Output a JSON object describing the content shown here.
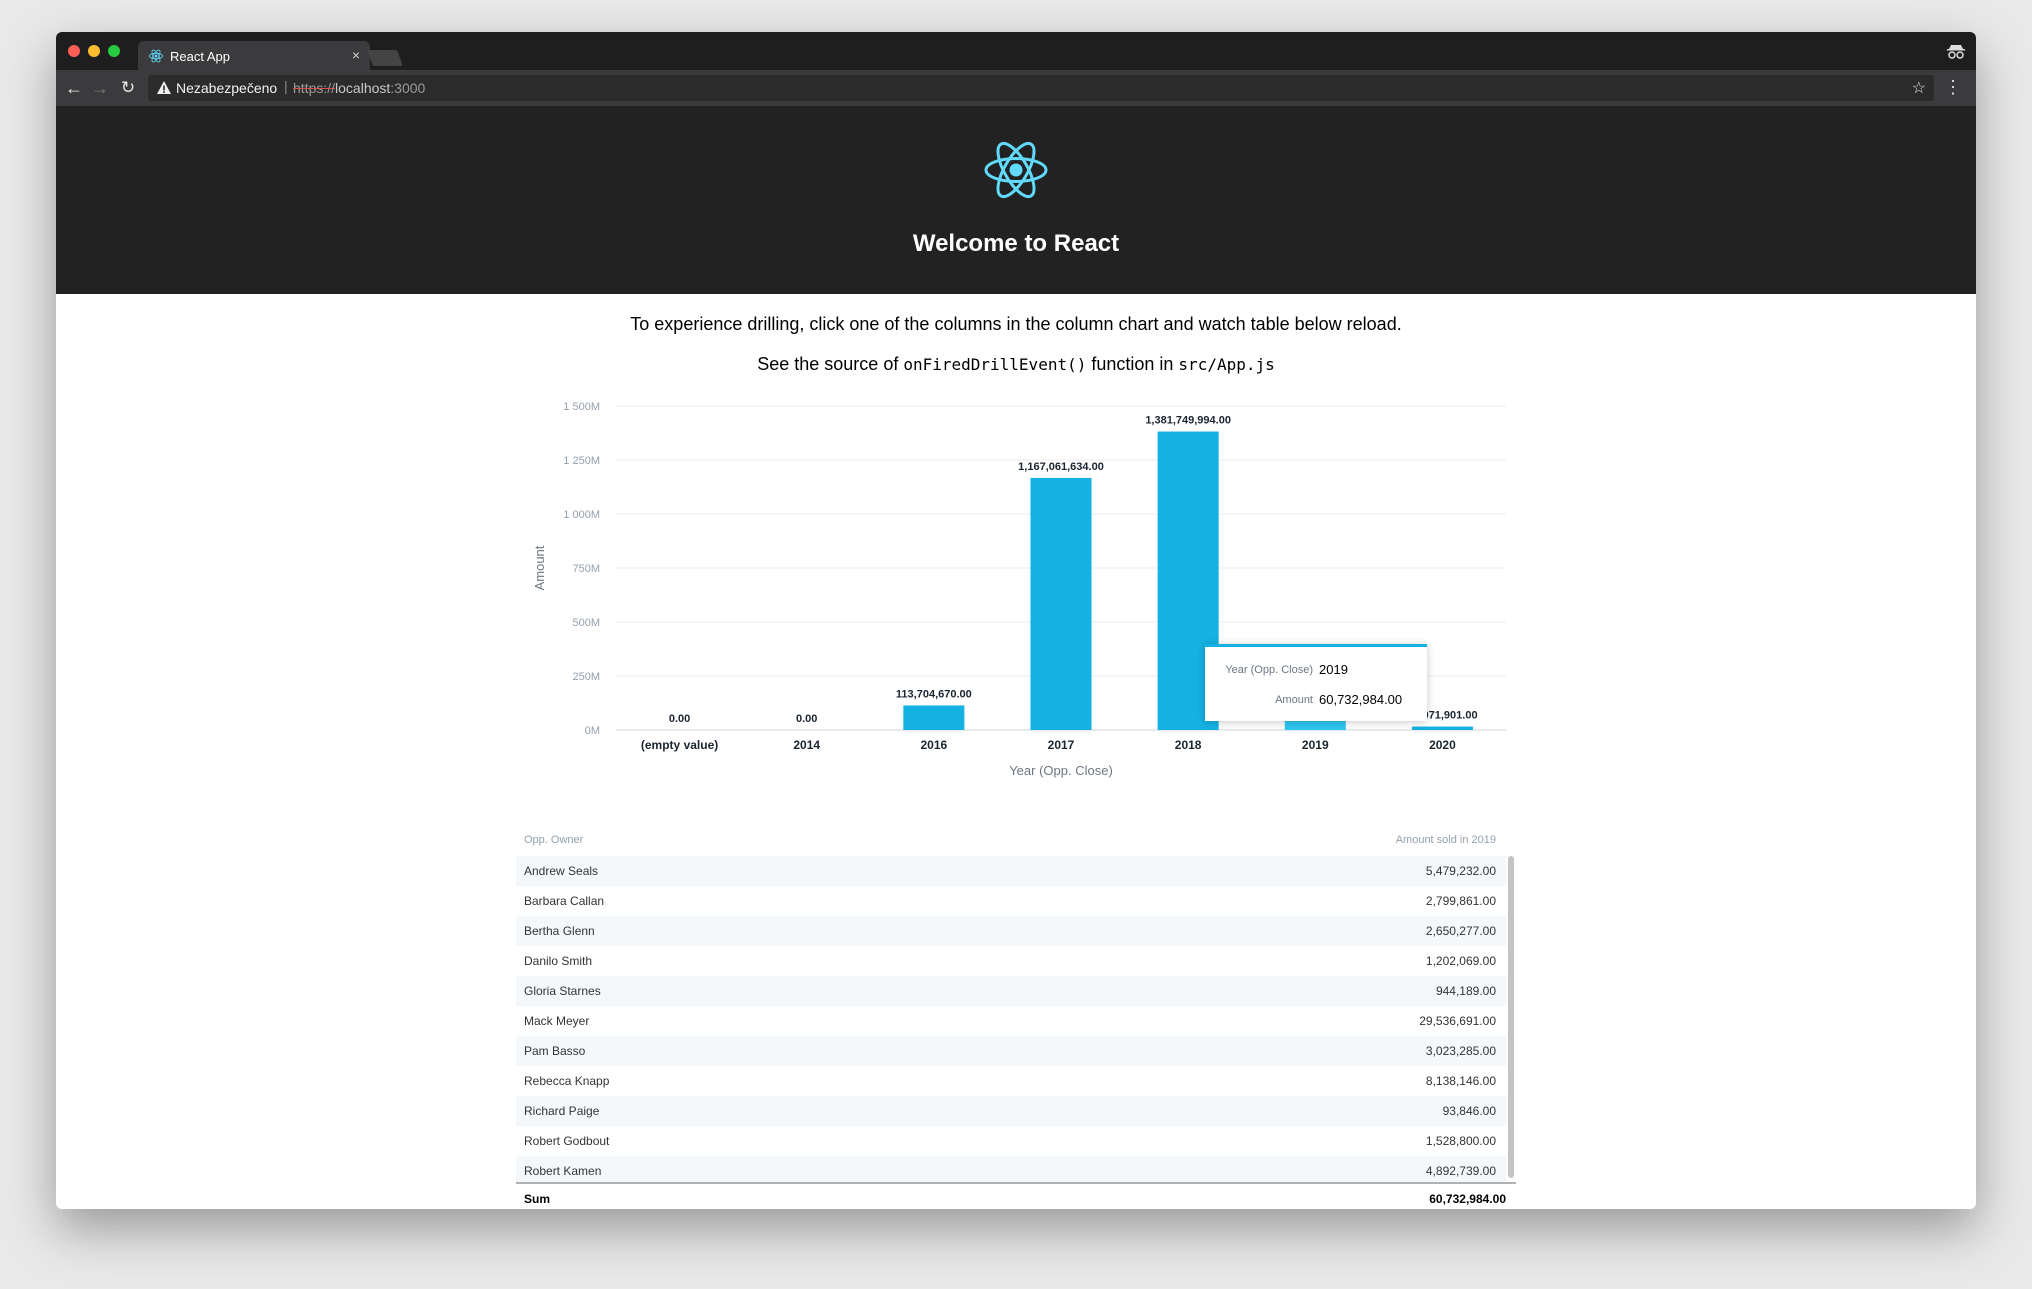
{
  "browser": {
    "tab_title": "React App",
    "tab_close": "×",
    "security_label": "Nezabezpečeno",
    "url_divider": "|",
    "url_scheme": "https://",
    "url_host": "localhost",
    "url_port": ":3000",
    "back_glyph": "←",
    "forward_glyph": "→",
    "reload_glyph": "↻",
    "star_glyph": "☆",
    "menu_glyph": "⋮"
  },
  "header": {
    "title": "Welcome to React"
  },
  "intro": {
    "line1": "To experience drilling, click one of the columns in the column chart and watch table below reload.",
    "line2_prefix": "See the source of ",
    "line2_function": "onFiredDrillEvent()",
    "line2_middle": " function in ",
    "line2_file": "src/App.js"
  },
  "chart_data": {
    "type": "bar",
    "categories": [
      "(empty value)",
      "2014",
      "2016",
      "2017",
      "2018",
      "2019",
      "2020"
    ],
    "values": [
      0,
      0,
      113704670,
      1167061634,
      1381749994,
      60732984,
      16071901
    ],
    "data_labels": [
      "0.00",
      "0.00",
      "113,704,670.00",
      "1,167,061,634.00",
      "1,381,749,994.00",
      "60,732,984.00",
      "16,071,901.00"
    ],
    "xlabel": "Year (Opp. Close)",
    "ylabel": "Amount",
    "ylim": [
      0,
      1500000000
    ],
    "y_ticks": [
      0,
      250000000,
      500000000,
      750000000,
      1000000000,
      1250000000,
      1500000000
    ],
    "y_tick_labels": [
      "0M",
      "250M",
      "500M",
      "750M",
      "1 000M",
      "1 250M",
      "1 500M"
    ],
    "highlighted_index": 5,
    "grid": true,
    "colors": {
      "bar": "#14b2e2",
      "bar_highlight": "#2ec6f2",
      "grid": "#ebebeb"
    }
  },
  "tooltip": {
    "rows": [
      {
        "label": "Year (Opp. Close)",
        "value": "2019"
      },
      {
        "label": "Amount",
        "value": "60,732,984.00"
      }
    ]
  },
  "table": {
    "header_left": "Opp. Owner",
    "header_right": "Amount sold in 2019",
    "rows": [
      {
        "owner": "Andrew Seals",
        "amount": "5,479,232.00"
      },
      {
        "owner": "Barbara Callan",
        "amount": "2,799,861.00"
      },
      {
        "owner": "Bertha Glenn",
        "amount": "2,650,277.00"
      },
      {
        "owner": "Danilo Smith",
        "amount": "1,202,069.00"
      },
      {
        "owner": "Gloria Starnes",
        "amount": "944,189.00"
      },
      {
        "owner": "Mack Meyer",
        "amount": "29,536,691.00"
      },
      {
        "owner": "Pam Basso",
        "amount": "3,023,285.00"
      },
      {
        "owner": "Rebecca Knapp",
        "amount": "8,138,146.00"
      },
      {
        "owner": "Richard Paige",
        "amount": "93,846.00"
      },
      {
        "owner": "Robert Godbout",
        "amount": "1,528,800.00"
      },
      {
        "owner": "Robert Kamen",
        "amount": "4,892,739.00"
      }
    ],
    "footer_label": "Sum",
    "footer_value": "60,732,984.00"
  }
}
